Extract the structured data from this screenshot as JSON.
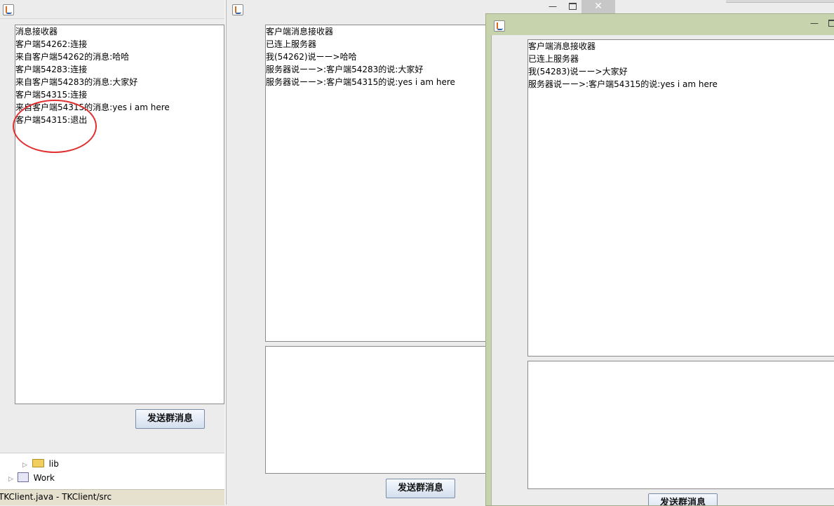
{
  "server": {
    "messages": [
      "消息接收器",
      "客户端54262:连接",
      "来自客户端54262的消息:哈哈",
      "客户端54283:连接",
      "来自客户端54283的消息:大家好",
      "客户端54315:连接",
      "来自客户端54315的消息:yes i am here",
      "客户端54315:退出"
    ],
    "send_button": "发送群消息"
  },
  "client1": {
    "messages": [
      "客户端消息接收器",
      "已连上服务器",
      "我(54262)说ーー>哈哈",
      "服务器说ーー>:客户端54283的说:大家好",
      "服务器说ーー>:客户端54315的说:yes i am here"
    ],
    "send_button": "发送群消息"
  },
  "client2": {
    "messages": [
      "客户端消息接收器",
      "已连上服务器",
      "我(54283)说ーー>大家好",
      "服务器说ーー>:客户端54315的说:yes i am here"
    ],
    "send_button": "发送群消息"
  },
  "explorer": {
    "items": [
      {
        "label": "lib",
        "icon": "folder-icon"
      },
      {
        "label": "Work",
        "icon": "project-icon"
      }
    ]
  },
  "statusbar": {
    "text": "TKClient.java - TKClient/src"
  },
  "colors": {
    "active_title": "#c6d3ad",
    "highlight": "#e03030"
  }
}
